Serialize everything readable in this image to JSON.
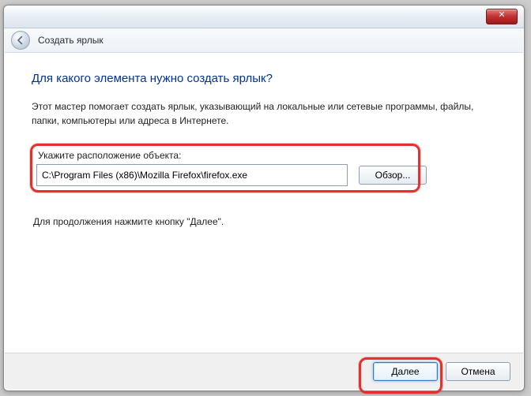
{
  "window": {
    "close_glyph": "✕"
  },
  "header": {
    "title": "Создать ярлык"
  },
  "main": {
    "heading": "Для какого элемента нужно создать ярлык?",
    "description": "Этот мастер помогает создать ярлык, указывающий на локальные или сетевые программы, файлы, папки, компьютеры или адреса в Интернете.",
    "field_label": "Укажите расположение объекта:",
    "location_value": "C:\\Program Files (x86)\\Mozilla Firefox\\firefox.exe",
    "browse_label": "Обзор...",
    "continue_hint": "Для продолжения нажмите кнопку \"Далее\"."
  },
  "footer": {
    "next_label": "Далее",
    "cancel_label": "Отмена"
  }
}
